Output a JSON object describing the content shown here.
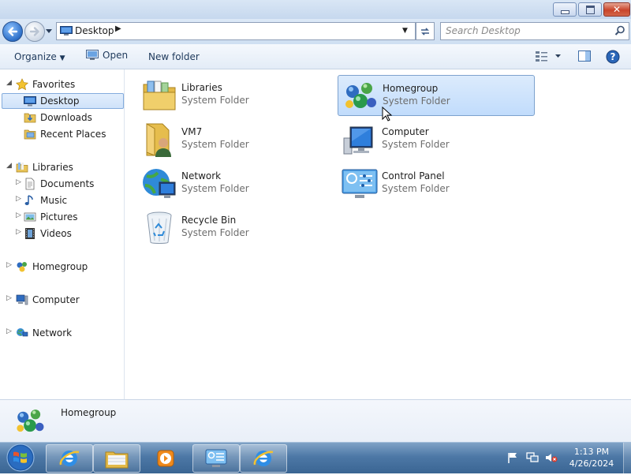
{
  "address": {
    "location": "Desktop"
  },
  "search": {
    "placeholder": "Search Desktop"
  },
  "toolbar": {
    "organize": "Organize",
    "open": "Open",
    "new_folder": "New folder"
  },
  "nav": {
    "favorites": "Favorites",
    "desktop": "Desktop",
    "downloads": "Downloads",
    "recent_places": "Recent Places",
    "libraries": "Libraries",
    "documents": "Documents",
    "music": "Music",
    "pictures": "Pictures",
    "videos": "Videos",
    "homegroup": "Homegroup",
    "computer": "Computer",
    "network": "Network"
  },
  "items": [
    {
      "name": "Libraries",
      "type": "System Folder",
      "icon": "libraries-icon"
    },
    {
      "name": "Homegroup",
      "type": "System Folder",
      "icon": "homegroup-icon",
      "selected": true
    },
    {
      "name": "VM7",
      "type": "System Folder",
      "icon": "user-folder-icon"
    },
    {
      "name": "Computer",
      "type": "System Folder",
      "icon": "computer-icon"
    },
    {
      "name": "Network",
      "type": "System Folder",
      "icon": "network-icon"
    },
    {
      "name": "Control Panel",
      "type": "System Folder",
      "icon": "control-panel-icon"
    },
    {
      "name": "Recycle Bin",
      "type": "System Folder",
      "icon": "recycle-bin-icon"
    }
  ],
  "details": {
    "name": "Homegroup"
  },
  "taskbar": {
    "buttons": [
      "internet-explorer",
      "windows-explorer",
      "media-player",
      "control-panel",
      "internet-explorer"
    ]
  },
  "clock": {
    "time": "1:13 PM",
    "date": "4/26/2024"
  }
}
